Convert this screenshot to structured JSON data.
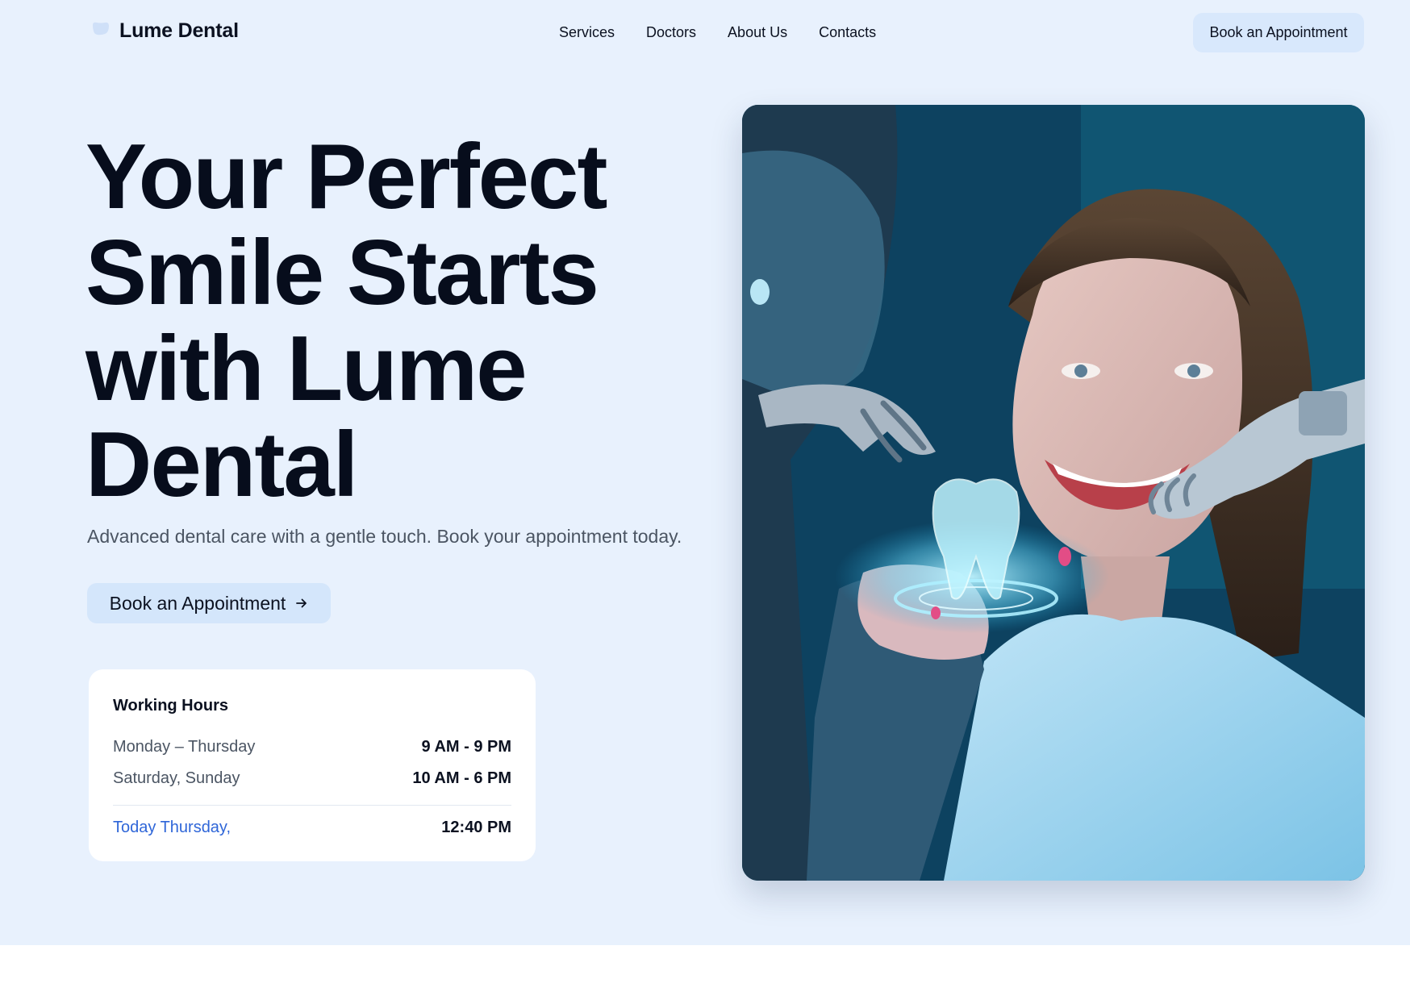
{
  "brand": {
    "name": "Lume Dental"
  },
  "nav": {
    "items": [
      {
        "label": "Services"
      },
      {
        "label": "Doctors"
      },
      {
        "label": "About Us"
      },
      {
        "label": "Contacts"
      }
    ]
  },
  "header": {
    "cta_label": "Book an Appointment"
  },
  "hero": {
    "headline": "Your Perfect Smile Starts with Lume Dental",
    "subtitle": "Advanced dental care with a gentle touch. Book your appointment today.",
    "cta_label": "Book an Appointment",
    "cta_icon": "arrow-right-icon",
    "image_icon": "dental-patient-photo"
  },
  "hours": {
    "title": "Working Hours",
    "rows": [
      {
        "day": "Monday – Thursday",
        "time": "9 AM - 9 PM"
      },
      {
        "day": "Saturday, Sunday",
        "time": "10 AM - 6 PM"
      }
    ],
    "today_label": "Today Thursday,",
    "today_time": "12:40 PM"
  },
  "colors": {
    "hero_bg": "#e8f1fd",
    "button_bg": "#d4e6fb",
    "accent": "#2f66d8",
    "text": "#0b1120"
  }
}
